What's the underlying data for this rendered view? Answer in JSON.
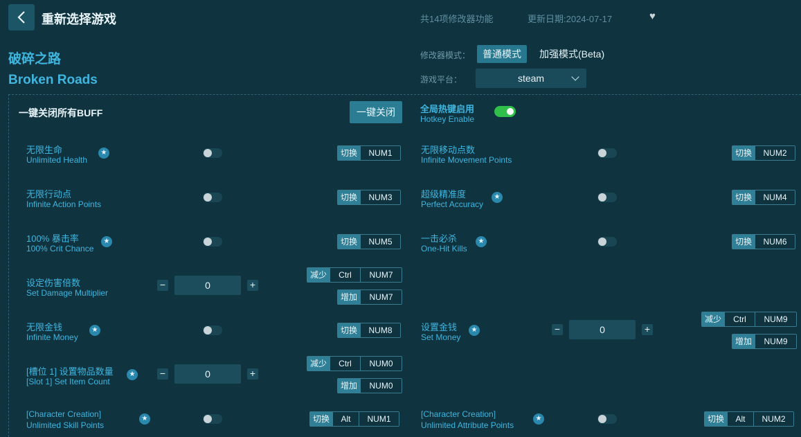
{
  "header": {
    "title": "重新选择游戏",
    "feature_count": "共14项修改器功能",
    "update_date": "更新日期:2024-07-17"
  },
  "game": {
    "name_cn": "破碎之路",
    "name_en": "Broken Roads"
  },
  "mode": {
    "label": "修改器模式：",
    "normal": "普通模式",
    "enhanced": "加强模式(Beta)"
  },
  "platform": {
    "label": "游戏平台：",
    "value": "steam"
  },
  "panel": {
    "close_all_label": "一键关闭所有BUFF",
    "close_all_button": "一键关闭",
    "hotkey_cn": "全局热键启用",
    "hotkey_en": "Hotkey Enable",
    "hotkey_enabled": true
  },
  "labels": {
    "toggle": "切换",
    "decrease": "减少",
    "increase": "增加"
  },
  "features": [
    {
      "cn": "无限生命",
      "en": "Unlimited Health",
      "star": true,
      "keys": [
        "NUM1"
      ]
    },
    {
      "cn": "无限移动点数",
      "en": "Infinite Movement Points",
      "star": false,
      "keys": [
        "NUM2"
      ]
    },
    {
      "cn": "无限行动点",
      "en": "Infinite Action Points",
      "star": false,
      "keys": [
        "NUM3"
      ]
    },
    {
      "cn": "超级精准度",
      "en": "Perfect Accuracy",
      "star": true,
      "keys": [
        "NUM4"
      ]
    },
    {
      "cn": "100% 暴击率",
      "en": "100% Crit Chance",
      "star": true,
      "keys": [
        "NUM5"
      ]
    },
    {
      "cn": "一击必杀",
      "en": "One-Hit Kills",
      "star": true,
      "keys": [
        "NUM6"
      ]
    },
    {
      "cn": "设定伤害倍数",
      "en": "Set Damage Multiplier",
      "star": false,
      "value": "0",
      "dec_keys": [
        "Ctrl",
        "NUM7"
      ],
      "inc_keys": [
        "NUM7"
      ]
    },
    {
      "cn": "无限金钱",
      "en": "Infinite Money",
      "star": true,
      "keys": [
        "NUM8"
      ]
    },
    {
      "cn": "设置金钱",
      "en": "Set Money",
      "star": true,
      "value": "0",
      "dec_keys": [
        "Ctrl",
        "NUM9"
      ],
      "inc_keys": [
        "NUM9"
      ]
    },
    {
      "cn": "[槽位 1] 设置物品数量",
      "en": "[Slot 1] Set Item Count",
      "star": true,
      "value": "0",
      "dec_keys": [
        "Ctrl",
        "NUM0"
      ],
      "inc_keys": [
        "NUM0"
      ]
    },
    {
      "cn": "[Character Creation]",
      "en": "Unlimited Skill Points",
      "star": true,
      "keys": [
        "Alt",
        "NUM1"
      ]
    },
    {
      "cn": "[Character Creation]",
      "en": "Unlimited Attribute Points",
      "star": true,
      "keys": [
        "Alt",
        "NUM2"
      ]
    }
  ],
  "colors": {
    "background": "#0f3440",
    "accent": "#3fb5df",
    "button": "#2a7d93",
    "toggle_on": "#2fbf4a"
  }
}
